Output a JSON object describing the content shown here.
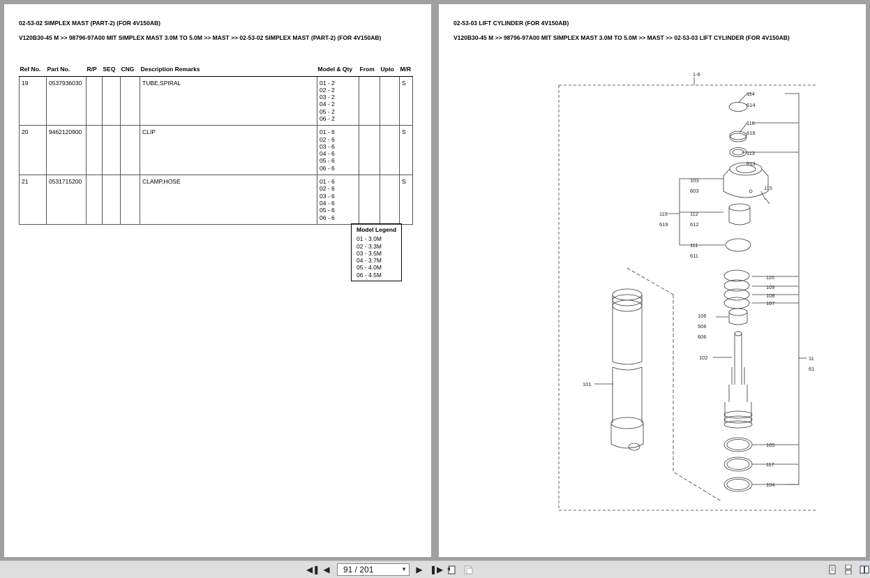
{
  "left_page": {
    "heading": "02-53-02 SIMPLEX MAST (PART-2) (FOR 4V150AB)",
    "breadcrumb": "V120B30-45 M >> 98796-97A00 MIT SIMPLEX MAST 3.0M TO 5.0M >> MAST >> 02-53-02 SIMPLEX MAST (PART-2) (FOR 4V150AB)",
    "columns": [
      "Ref No.",
      "Part No.",
      "R/P",
      "SEQ",
      "CNG",
      "Description Remarks",
      "Model & Qty",
      "From",
      "Upto",
      "M/R"
    ],
    "rows": [
      {
        "ref": "19",
        "part": "0537936030",
        "rp": "",
        "seq": "",
        "cng": "",
        "desc": "TUBE,SPIRAL",
        "models": [
          "01 - 2",
          "02 - 2",
          "03 - 2",
          "04 - 2",
          "05 - 2",
          "06 - 2"
        ],
        "from": "",
        "upto": "",
        "mr": "S"
      },
      {
        "ref": "20",
        "part": "9462120900",
        "rp": "",
        "seq": "",
        "cng": "",
        "desc": "CLIP",
        "models": [
          "01 - 6",
          "02 - 6",
          "03 - 6",
          "04 - 6",
          "05 - 6",
          "06 - 6"
        ],
        "from": "",
        "upto": "",
        "mr": "S"
      },
      {
        "ref": "21",
        "part": "0531715200",
        "rp": "",
        "seq": "",
        "cng": "",
        "desc": "CLAMP,HOSE",
        "models": [
          "01 - 6",
          "02 - 6",
          "03 - 6",
          "04 - 6",
          "05 - 6",
          "06 - 6"
        ],
        "from": "",
        "upto": "",
        "mr": "S"
      }
    ],
    "legend": {
      "title": "Model Legend",
      "items": [
        "01 - 3.0M",
        "02 - 3.3M",
        "03 - 3.5M",
        "04 - 3.7M",
        "05 - 4.0M",
        "06 - 4.5M"
      ]
    }
  },
  "right_page": {
    "heading": "02-53-03 LIFT CYLINDER (FOR 4V150AB)",
    "breadcrumb": "V120B30-45 M >> 98796-97A00 MIT SIMPLEX MAST 3.0M TO 5.0M >> MAST >> 02-53-03 LIFT CYLINDER (FOR 4V150AB)",
    "diagram_labels": {
      "top": "1-6",
      "l114": "114",
      "l614": "614",
      "l116": "116",
      "l616": "616",
      "l113": "113",
      "l613": "613",
      "l103": "103",
      "l603": "603",
      "l115": "115",
      "l119": "119",
      "l619": "619",
      "l112": "112",
      "l612": "612",
      "l111": "111",
      "l611": "611",
      "l110": "110",
      "l109": "109",
      "l108": "108",
      "l107": "107",
      "l106": "106",
      "l506": "506",
      "l606": "606",
      "l102": "102",
      "l101": "101",
      "l11": "11",
      "l61": "61",
      "l105": "105",
      "l117": "117",
      "l104": "104"
    }
  },
  "toolbar": {
    "page_indicator": "91 / 201",
    "icons": {
      "first": "first-page-icon",
      "prev": "prev-page-icon",
      "next": "next-page-icon",
      "last": "last-page-icon",
      "back": "back-view-icon",
      "forward": "forward-view-icon",
      "single": "single-page-icon",
      "continuous": "continuous-page-icon",
      "facing": "facing-pages-icon"
    }
  }
}
